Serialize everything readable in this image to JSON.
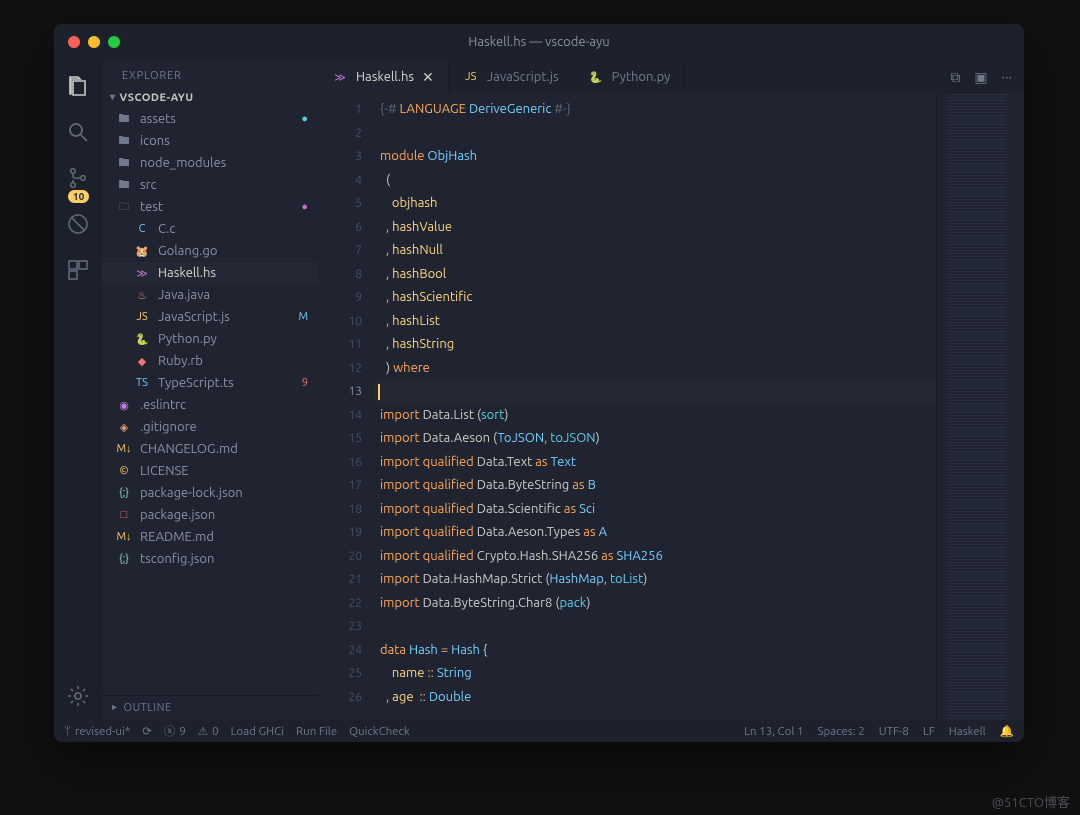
{
  "window": {
    "title": "Haskell.hs — vscode-ayu"
  },
  "activitybar": {
    "badge": "10",
    "items": [
      {
        "name": "files",
        "active": true
      },
      {
        "name": "search",
        "active": false
      },
      {
        "name": "scm",
        "active": false
      },
      {
        "name": "debug",
        "active": false
      },
      {
        "name": "extensions",
        "active": false
      }
    ],
    "settings_icon": "gear"
  },
  "sidebar": {
    "title": "EXPLORER",
    "section": "VSCODE-AYU",
    "outline": "OUTLINE",
    "tree": [
      {
        "depth": 1,
        "icon": "folder",
        "label": "assets",
        "deco": "●",
        "decoColor": "#5ccfe6"
      },
      {
        "depth": 1,
        "icon": "folder",
        "label": "icons"
      },
      {
        "depth": 1,
        "icon": "folder",
        "label": "node_modules"
      },
      {
        "depth": 1,
        "icon": "folder",
        "label": "src"
      },
      {
        "depth": 1,
        "icon": "folder-open",
        "label": "test",
        "deco": "●",
        "decoColor": "#c06ece"
      },
      {
        "depth": 2,
        "icon": "c",
        "iconColor": "#73d0ff",
        "label": "C.c"
      },
      {
        "depth": 2,
        "icon": "go",
        "iconColor": "#5ccfe6",
        "label": "Golang.go"
      },
      {
        "depth": 2,
        "icon": "hs",
        "iconColor": "#c679dc",
        "label": "Haskell.hs",
        "selected": true
      },
      {
        "depth": 2,
        "icon": "java",
        "iconColor": "#f28779",
        "label": "Java.java"
      },
      {
        "depth": 2,
        "icon": "js",
        "iconColor": "#ffcc66",
        "label": "JavaScript.js",
        "deco": "M",
        "decoColor": "#73d0ff"
      },
      {
        "depth": 2,
        "icon": "py",
        "iconColor": "#ffcc66",
        "label": "Python.py"
      },
      {
        "depth": 2,
        "icon": "rb",
        "iconColor": "#f07171",
        "label": "Ruby.rb"
      },
      {
        "depth": 2,
        "icon": "ts",
        "iconColor": "#73d0ff",
        "label": "TypeScript.ts",
        "deco": "9",
        "decoColor": "#f07171"
      },
      {
        "depth": 1,
        "icon": "eslint",
        "iconColor": "#c679dc",
        "label": ".eslintrc"
      },
      {
        "depth": 1,
        "icon": "git",
        "iconColor": "#f29e74",
        "label": ".gitignore"
      },
      {
        "depth": 1,
        "icon": "md",
        "iconColor": "#ffcc66",
        "label": "CHANGELOG.md"
      },
      {
        "depth": 1,
        "icon": "lic",
        "iconColor": "#ffcc66",
        "label": "LICENSE"
      },
      {
        "depth": 1,
        "icon": "json",
        "iconColor": "#95e6cb",
        "label": "package-lock.json"
      },
      {
        "depth": 1,
        "icon": "npm",
        "iconColor": "#f07171",
        "label": "package.json"
      },
      {
        "depth": 1,
        "icon": "md",
        "iconColor": "#ffcc66",
        "label": "README.md"
      },
      {
        "depth": 1,
        "icon": "json",
        "iconColor": "#95e6cb",
        "label": "tsconfig.json"
      }
    ]
  },
  "tabs": {
    "items": [
      {
        "icon": "hs",
        "iconColor": "#c679dc",
        "label": "Haskell.hs",
        "active": true,
        "close": "✕"
      },
      {
        "icon": "js",
        "iconColor": "#ffcc66",
        "label": "JavaScript.js",
        "active": false
      },
      {
        "icon": "py",
        "iconColor": "#ffcc66",
        "label": "Python.py",
        "active": false
      }
    ],
    "actions": {
      "diff": "⧉",
      "split": "▣",
      "more": "···"
    }
  },
  "editor": {
    "current_line": 13,
    "lines": [
      {
        "n": 1,
        "html": "<span class='cm'>{-#</span> <span class='kw'>LANGUAGE</span> <span class='ty'>DeriveGeneric</span> <span class='cm'>#-}</span>"
      },
      {
        "n": 2,
        "html": ""
      },
      {
        "n": 3,
        "html": "<span class='kw'>module</span> <span class='ty'>ObjHash</span>"
      },
      {
        "n": 4,
        "html": "  <span class='pun'>(</span>"
      },
      {
        "n": 5,
        "html": "    <span class='fn'>objhash</span>"
      },
      {
        "n": 6,
        "html": "  <span class='op'>,</span> <span class='fn'>hashValue</span>"
      },
      {
        "n": 7,
        "html": "  <span class='op'>,</span> <span class='fn'>hashNull</span>"
      },
      {
        "n": 8,
        "html": "  <span class='op'>,</span> <span class='fn'>hashBool</span>"
      },
      {
        "n": 9,
        "html": "  <span class='op'>,</span> <span class='fn'>hashScientific</span>"
      },
      {
        "n": 10,
        "html": "  <span class='op'>,</span> <span class='fn'>hashList</span>"
      },
      {
        "n": 11,
        "html": "  <span class='op'>,</span> <span class='fn'>hashString</span>"
      },
      {
        "n": 12,
        "html": "  <span class='pun'>)</span> <span class='kw'>where</span>"
      },
      {
        "n": 13,
        "html": "",
        "hl": true,
        "cursor": true
      },
      {
        "n": 14,
        "html": "<span class='kw'>import</span> <span class='pun'>Data.List</span> <span class='pun'>(</span><span class='imp'>sort</span><span class='pun'>)</span>"
      },
      {
        "n": 15,
        "html": "<span class='kw'>import</span> <span class='pun'>Data.Aeson</span> <span class='pun'>(</span><span class='ty'>ToJSON</span><span class='op'>,</span> <span class='imp'>toJSON</span><span class='pun'>)</span>"
      },
      {
        "n": 16,
        "html": "<span class='kw'>import</span> <span class='kw'>qualified</span> <span class='pun'>Data.Text</span> <span class='kw'>as</span> <span class='ty'>Text</span>"
      },
      {
        "n": 17,
        "html": "<span class='kw'>import</span> <span class='kw'>qualified</span> <span class='pun'>Data.ByteString</span> <span class='kw'>as</span> <span class='ty'>B</span>"
      },
      {
        "n": 18,
        "html": "<span class='kw'>import</span> <span class='kw'>qualified</span> <span class='pun'>Data.Scientific</span> <span class='kw'>as</span> <span class='ty'>Sci</span>"
      },
      {
        "n": 19,
        "html": "<span class='kw'>import</span> <span class='kw'>qualified</span> <span class='pun'>Data.Aeson.Types</span> <span class='kw'>as</span> <span class='ty'>A</span>"
      },
      {
        "n": 20,
        "html": "<span class='kw'>import</span> <span class='kw'>qualified</span> <span class='pun'>Crypto.Hash.SHA256</span> <span class='kw'>as</span> <span class='ty'>SHA256</span>"
      },
      {
        "n": 21,
        "html": "<span class='kw'>import</span> <span class='pun'>Data.HashMap.Strict</span> <span class='pun'>(</span><span class='ty'>HashMap</span><span class='op'>,</span> <span class='imp'>toList</span><span class='pun'>)</span>"
      },
      {
        "n": 22,
        "html": "<span class='kw'>import</span> <span class='pun'>Data.ByteString.Char8</span> <span class='pun'>(</span><span class='imp'>pack</span><span class='pun'>)</span>"
      },
      {
        "n": 23,
        "html": ""
      },
      {
        "n": 24,
        "html": "<span class='kw'>data</span> <span class='ty'>Hash</span> <span class='op'>=</span> <span class='ty'>Hash</span> <span class='pun'>{</span>"
      },
      {
        "n": 25,
        "html": "    <span class='fn'>name</span> <span class='op'>::</span> <span class='ty'>String</span>"
      },
      {
        "n": 26,
        "html": "  <span class='op'>,</span> <span class='fn'>age</span>  <span class='op'>::</span> <span class='ty'>Double</span>"
      }
    ]
  },
  "statusbar": {
    "left": [
      {
        "icon": "branch",
        "text": "revised-ui*"
      },
      {
        "icon": "sync",
        "text": ""
      },
      {
        "icon": "error",
        "text": "9"
      },
      {
        "icon": "warn",
        "text": "0"
      },
      {
        "text": "Load GHCi"
      },
      {
        "text": "Run File"
      },
      {
        "text": "QuickCheck"
      }
    ],
    "right": [
      {
        "text": "Ln 13, Col 1"
      },
      {
        "text": "Spaces: 2"
      },
      {
        "text": "UTF-8"
      },
      {
        "text": "LF"
      },
      {
        "text": "Haskell"
      },
      {
        "icon": "bell",
        "text": ""
      }
    ]
  },
  "colors": {
    "accent": "#ffcc66",
    "bg": "#1f2430"
  },
  "watermark": "@51CTO博客"
}
